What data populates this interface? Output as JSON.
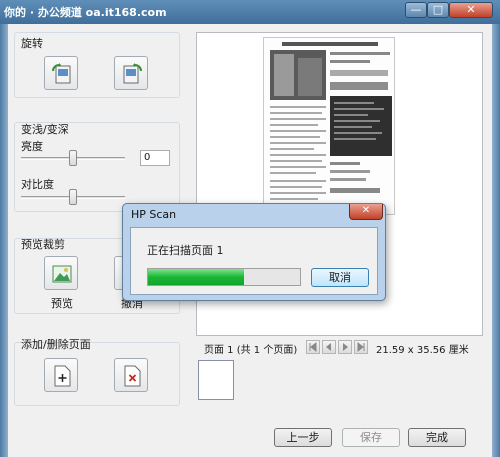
{
  "window": {
    "title": "你的 · 办公频道  oa.it168.com",
    "minimize_glyph": "—",
    "maximize_glyph": "□",
    "close_glyph": "✕"
  },
  "rotate": {
    "title": "旋转"
  },
  "adjust": {
    "title": "变浅/变深",
    "brightness_label": "亮度",
    "brightness_value": "0",
    "brightness_level": 0.5,
    "contrast_label": "对比度",
    "contrast_level": 0.5
  },
  "crop": {
    "title": "预览裁剪",
    "preview_label": "预览",
    "undo_label": "撤消"
  },
  "pages": {
    "title": "添加/删除页面"
  },
  "preview": {
    "page_info": "页面 1 (共 1 个页面)",
    "page_size": "21.59 x 35.56 厘米"
  },
  "actions": {
    "back_label": "上一步",
    "save_label": "保存",
    "finish_label": "完成"
  },
  "dialog": {
    "title": "HP Scan",
    "message": "正在扫描页面 1",
    "progress": 0.63,
    "cancel_label": "取消"
  },
  "colors": {
    "progress_green": "#1bb635",
    "titlebar": "#4f7fab"
  }
}
